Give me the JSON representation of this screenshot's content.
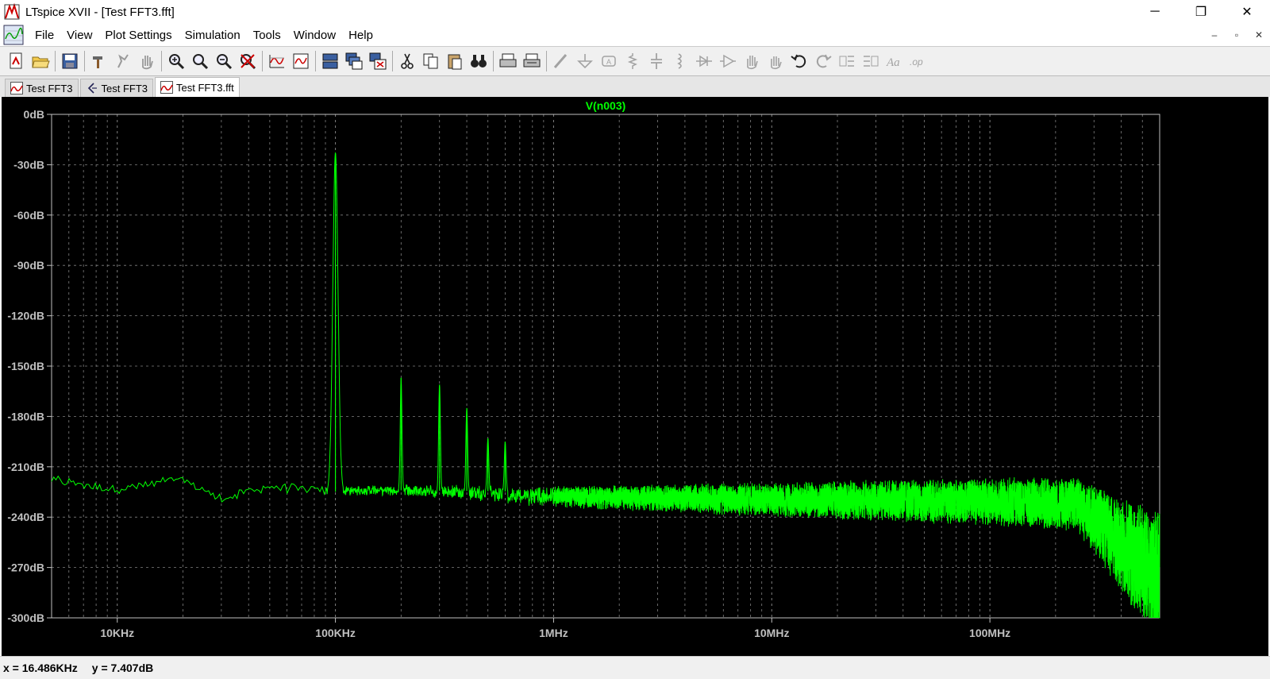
{
  "window": {
    "title": "LTspice XVII - [Test FFT3.fft]",
    "controls": {
      "minimize": "─",
      "restore": "❐",
      "close": "✕"
    }
  },
  "menu": {
    "items": [
      "File",
      "View",
      "Plot Settings",
      "Simulation",
      "Tools",
      "Window",
      "Help"
    ],
    "mdi_controls": [
      "‒",
      "▫",
      "✕"
    ]
  },
  "toolbar": {
    "buttons": [
      {
        "icon": "new-schematic-icon",
        "enabled": true
      },
      {
        "icon": "open-folder-icon",
        "enabled": true
      },
      {
        "sep": true
      },
      {
        "icon": "save-icon",
        "enabled": true
      },
      {
        "sep": true
      },
      {
        "icon": "control-panel-hammer-icon",
        "enabled": true
      },
      {
        "icon": "run-icon",
        "enabled": false
      },
      {
        "icon": "halt-hand-icon",
        "enabled": false
      },
      {
        "sep": true
      },
      {
        "icon": "zoom-area-icon",
        "enabled": true
      },
      {
        "icon": "zoom-in-icon",
        "enabled": true
      },
      {
        "icon": "zoom-out-icon",
        "enabled": true
      },
      {
        "icon": "zoom-cancel-icon",
        "enabled": true
      },
      {
        "sep": true
      },
      {
        "icon": "autorange-icon",
        "enabled": true
      },
      {
        "icon": "pick-visible-traces-icon",
        "enabled": true
      },
      {
        "sep": true
      },
      {
        "icon": "tile-vertical-icon",
        "enabled": true
      },
      {
        "icon": "cascade-windows-icon",
        "enabled": true
      },
      {
        "icon": "close-windows-icon",
        "enabled": true
      },
      {
        "sep": true
      },
      {
        "icon": "cut-icon",
        "enabled": true
      },
      {
        "icon": "copy-icon",
        "enabled": true
      },
      {
        "icon": "paste-icon",
        "enabled": true
      },
      {
        "icon": "find-binoculars-icon",
        "enabled": true
      },
      {
        "sep": true
      },
      {
        "icon": "print-icon",
        "enabled": true
      },
      {
        "icon": "print-preview-icon",
        "enabled": true
      },
      {
        "sep": true
      },
      {
        "icon": "draw-wire-icon",
        "enabled": false
      },
      {
        "icon": "ground-icon",
        "enabled": false
      },
      {
        "icon": "net-label-icon",
        "enabled": false
      },
      {
        "icon": "resistor-icon",
        "enabled": false
      },
      {
        "icon": "capacitor-icon",
        "enabled": false
      },
      {
        "icon": "inductor-icon",
        "enabled": false
      },
      {
        "icon": "diode-icon",
        "enabled": false
      },
      {
        "icon": "component-icon",
        "enabled": false
      },
      {
        "icon": "move-hand-icon",
        "enabled": false
      },
      {
        "icon": "drag-hand-icon",
        "enabled": false
      },
      {
        "icon": "undo-icon",
        "enabled": true
      },
      {
        "icon": "redo-icon",
        "enabled": false
      },
      {
        "icon": "rotate-icon",
        "enabled": false
      },
      {
        "icon": "mirror-icon",
        "enabled": false
      },
      {
        "icon": "text-icon",
        "enabled": false
      },
      {
        "icon": "spice-directive-icon",
        "enabled": false
      }
    ]
  },
  "tabs": [
    {
      "label": "Test FFT3",
      "icon": "waveform-tab-icon",
      "active": false
    },
    {
      "label": "Test FFT3",
      "icon": "schematic-tab-icon",
      "active": false
    },
    {
      "label": "Test FFT3.fft",
      "icon": "waveform-tab-icon",
      "active": true
    }
  ],
  "status": {
    "x_readout": "x = 16.486KHz",
    "y_readout": "y = 7.407dB"
  },
  "chart_data": {
    "type": "line",
    "title": "V(n003)",
    "xlabel": "",
    "ylabel": "",
    "x_scale": "log",
    "xlim": [
      5000,
      600000000
    ],
    "ylim": [
      -300,
      0
    ],
    "x_ticks": [
      {
        "value": 10000,
        "label": "10KHz"
      },
      {
        "value": 100000,
        "label": "100KHz"
      },
      {
        "value": 1000000,
        "label": "1MHz"
      },
      {
        "value": 10000000,
        "label": "10MHz"
      },
      {
        "value": 100000000,
        "label": "100MHz"
      }
    ],
    "y_ticks": [
      {
        "value": 0,
        "label": "0dB"
      },
      {
        "value": -30,
        "label": "-30dB"
      },
      {
        "value": -60,
        "label": "-60dB"
      },
      {
        "value": -90,
        "label": "-90dB"
      },
      {
        "value": -120,
        "label": "-120dB"
      },
      {
        "value": -150,
        "label": "-150dB"
      },
      {
        "value": -180,
        "label": "-180dB"
      },
      {
        "value": -210,
        "label": "-210dB"
      },
      {
        "value": -240,
        "label": "-240dB"
      },
      {
        "value": -270,
        "label": "-270dB"
      },
      {
        "value": -300,
        "label": "-300dB"
      }
    ],
    "grid": true,
    "background": "#000000",
    "grid_color": "#808080",
    "series": [
      {
        "name": "V(n003)",
        "color": "#00ff00",
        "peaks": [
          {
            "x": 100000,
            "y": -23
          },
          {
            "x": 200000,
            "y": -157
          },
          {
            "x": 300000,
            "y": -161
          },
          {
            "x": 400000,
            "y": -175
          },
          {
            "x": 500000,
            "y": -193
          },
          {
            "x": 600000,
            "y": -195
          }
        ],
        "floor": [
          {
            "x": 5000,
            "y": -218
          },
          {
            "x": 10000,
            "y": -224
          },
          {
            "x": 20000,
            "y": -218
          },
          {
            "x": 30000,
            "y": -230
          },
          {
            "x": 50000,
            "y": -222
          },
          {
            "x": 90000,
            "y": -225
          },
          {
            "x": 200000,
            "y": -224
          },
          {
            "x": 1000000,
            "y": -225
          },
          {
            "x": 10000000,
            "y": -223
          },
          {
            "x": 100000000,
            "y": -220
          },
          {
            "x": 250000000,
            "y": -220
          },
          {
            "x": 600000000,
            "y": -240
          }
        ]
      }
    ]
  }
}
